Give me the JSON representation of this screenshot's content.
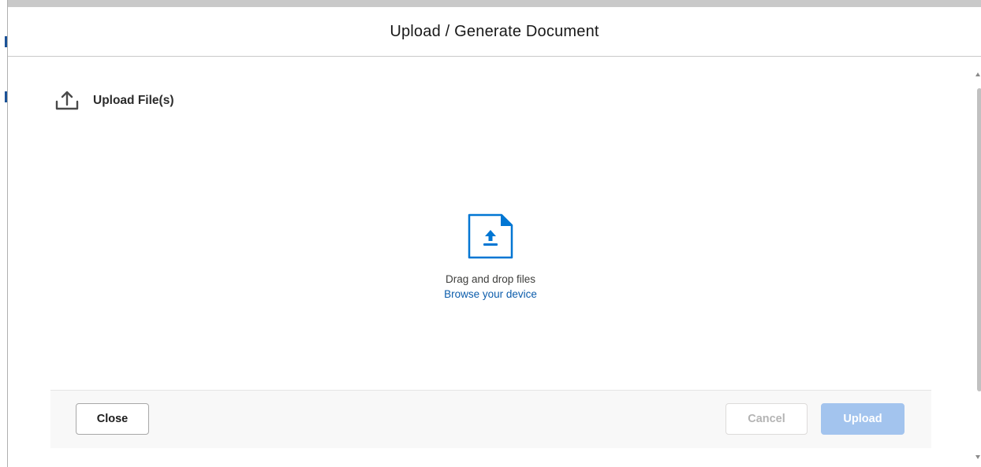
{
  "modal": {
    "title": "Upload / Generate Document"
  },
  "section": {
    "label": "Upload File(s)",
    "icon": "upload-icon"
  },
  "dropzone": {
    "icon": "file-upload-icon",
    "instruction": "Drag and drop files",
    "browse_link": "Browse your device"
  },
  "footer": {
    "close_label": "Close",
    "cancel_label": "Cancel",
    "upload_label": "Upload"
  },
  "colors": {
    "accent": "#0b5cab",
    "upload_disabled": "#a3c4ee",
    "icon_blue": "#0176d3"
  }
}
